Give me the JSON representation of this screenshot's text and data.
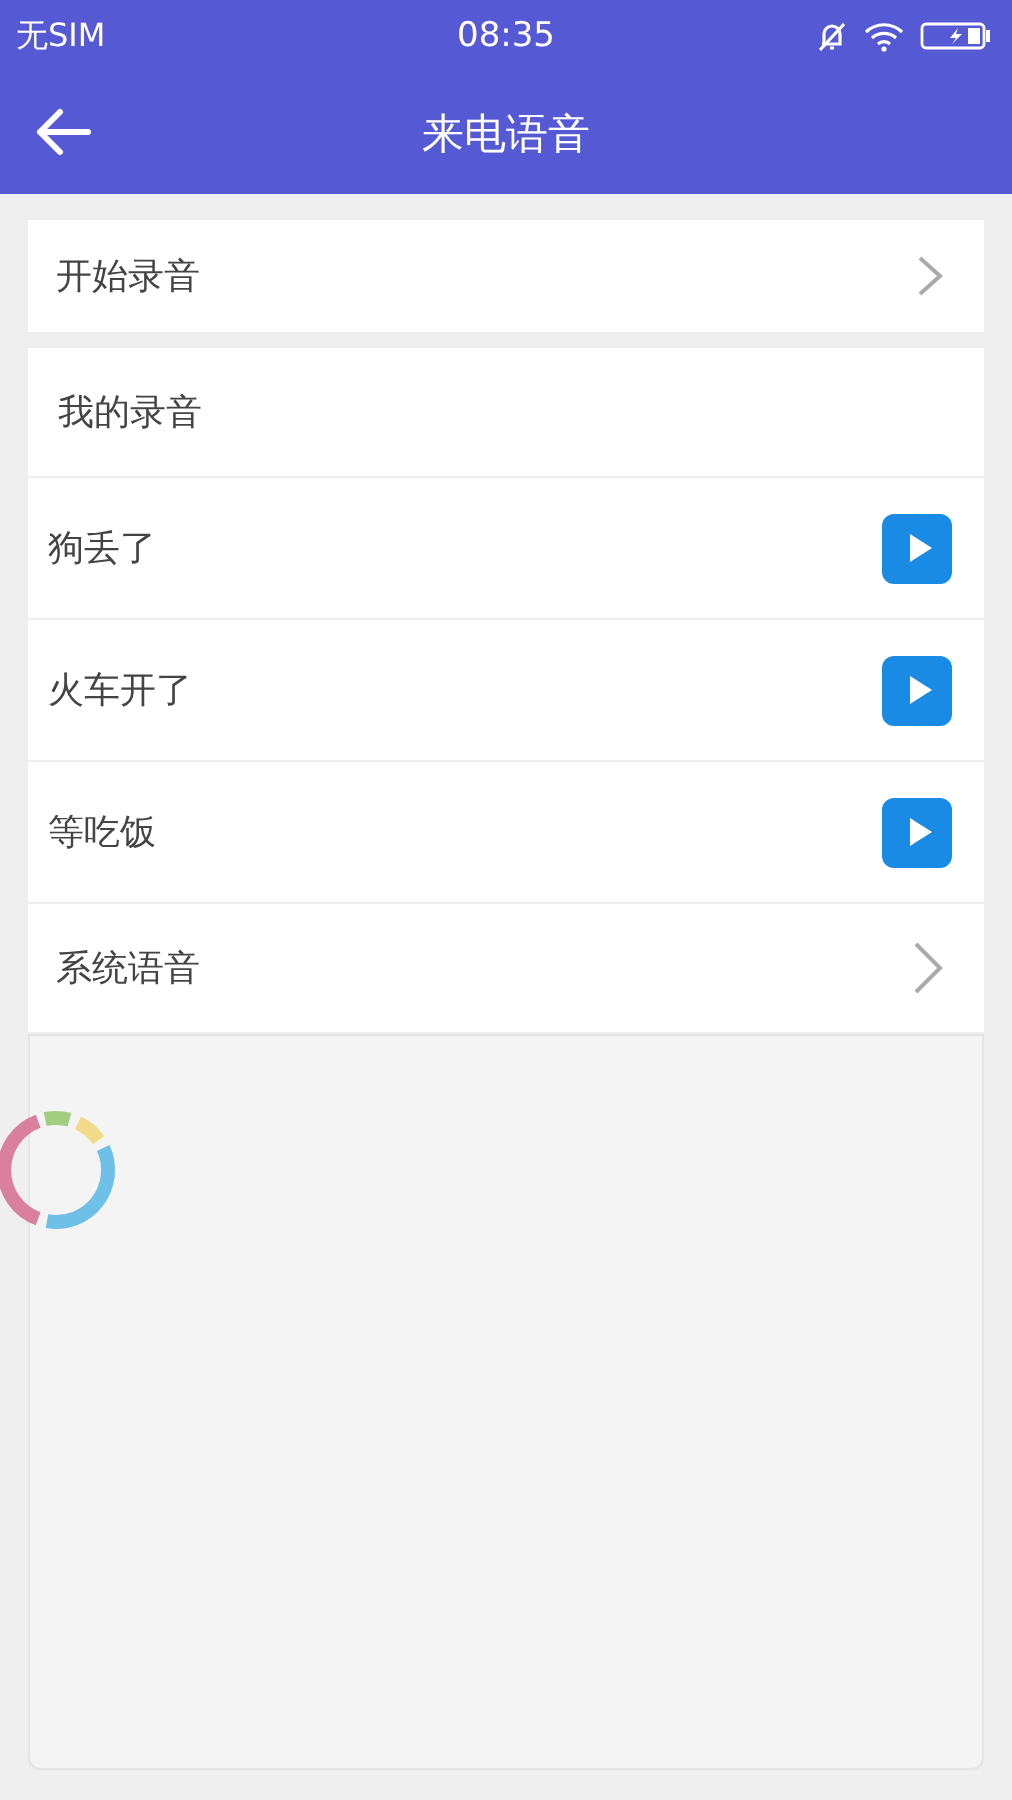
{
  "status_bar": {
    "carrier": "无SIM",
    "time": "08:35"
  },
  "header": {
    "title": "来电语音"
  },
  "start_recording": {
    "label": "开始录音"
  },
  "my_recordings": {
    "title": "我的录音",
    "items": [
      {
        "label": "狗丢了"
      },
      {
        "label": "火车开了"
      },
      {
        "label": "等吃饭"
      }
    ]
  },
  "system_voice": {
    "label": "系统语音"
  }
}
